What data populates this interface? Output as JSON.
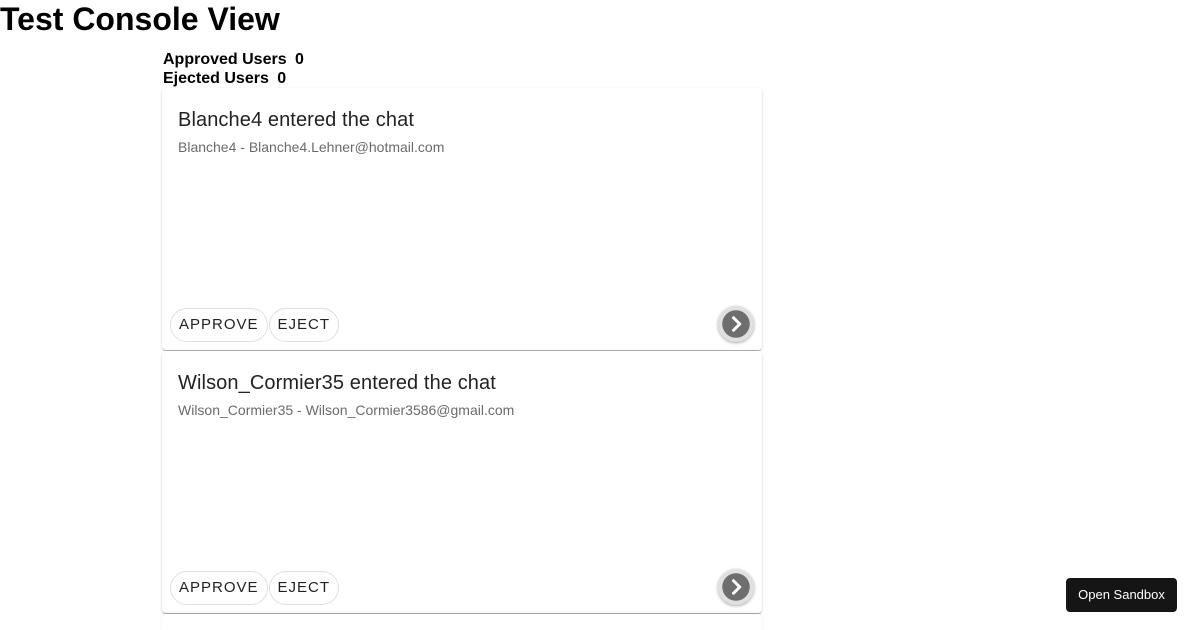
{
  "page": {
    "title": "Test Console View"
  },
  "stats": {
    "approved_label": "Approved Users",
    "approved_count": "0",
    "ejected_label": "Ejected Users",
    "ejected_count": "0"
  },
  "cards": [
    {
      "title": "Blanche4 entered the chat",
      "subtitle": "Blanche4 - Blanche4.Lehner@hotmail.com",
      "approve_label": "APPROVE",
      "eject_label": "EJECT",
      "next_icon": "chevron-right-icon"
    },
    {
      "title": "Wilson_Cormier35 entered the chat",
      "subtitle": "Wilson_Cormier35 - Wilson_Cormier3586@gmail.com",
      "approve_label": "APPROVE",
      "eject_label": "EJECT",
      "next_icon": "chevron-right-icon"
    }
  ],
  "sandbox": {
    "label": "Open Sandbox"
  },
  "colors": {
    "sandbox_bg": "#151515",
    "next_icon_fill": "#6e6e6e",
    "subtitle": "#6b6b6b"
  }
}
